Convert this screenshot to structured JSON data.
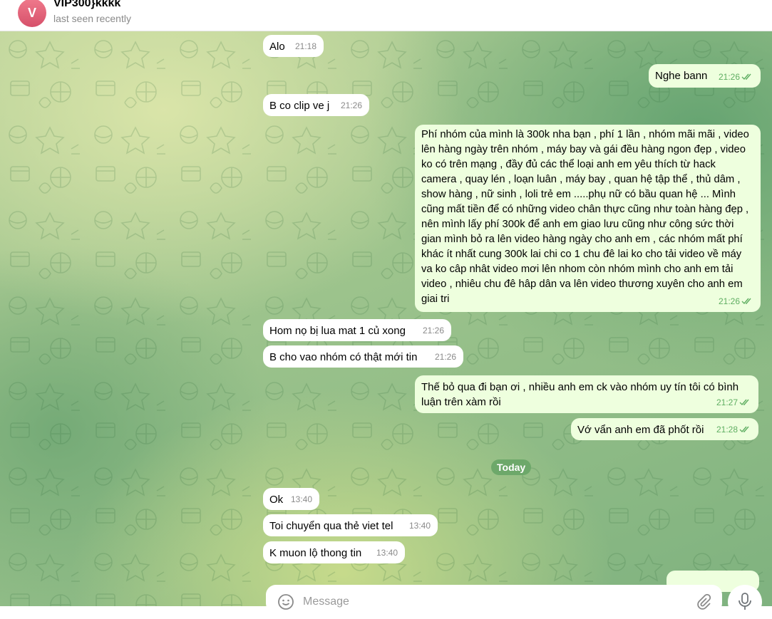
{
  "header": {
    "avatar_letter": "V",
    "title": "VIP300}kkkk",
    "status": "last seen recently"
  },
  "colors": {
    "outgoing_bubble": "#eeffde",
    "incoming_bubble": "#ffffff",
    "read_ticks": "#5fae62",
    "date_badge": "#6da86a",
    "avatar": "#e0607a"
  },
  "messages": [
    {
      "dir": "in",
      "text": "Alo",
      "time": "21:18"
    },
    {
      "dir": "out",
      "text": "Nghe bann",
      "time": "21:26",
      "status": "read"
    },
    {
      "dir": "in",
      "text": "B co clip ve j",
      "time": "21:26"
    },
    {
      "dir": "out",
      "text": "Phí nhóm của mình là 300k nha bạn , phí 1 lần , nhóm mãi mãi , video lên hàng ngày trên nhóm , máy bay và gái đều hàng ngon đẹp , video ko có trên mạng , đầy đủ các thể loại anh em yêu thích từ hack camera , quay lén , loạn luân , máy bay , quan hệ tập thể , thủ dâm , show hàng , nữ sinh , loli trẻ em .....phụ nữ có bầu quan hệ ... Mình cũng mất tiền để có những video chân thực cũng như toàn hàng đẹp , nên mình lấy phí 300k để anh em giao lưu cũng như công sức thời gian mình bỏ ra lên video hàng ngày cho anh em , các nhóm mất phí khác ít nhất cung 300k lai chi co 1 chu đê lai ko cho tải video về máy va ko câp nhât video mơi lên nhom còn nhóm mình cho anh em tải video , nhiêu chu đê hâp dân va lên video thương xuyên cho anh em giai tri",
      "time": "21:26",
      "status": "read"
    },
    {
      "dir": "in",
      "text": "Hom nọ bị lua mat 1 củ xong",
      "time": "21:26"
    },
    {
      "dir": "in",
      "text": "B cho vao nhóm có thật mới tin",
      "time": "21:26"
    },
    {
      "dir": "out",
      "text": "Thế bỏ qua đi bạn ơi , nhiều anh em ck vào nhóm uy tín tôi có bình luận trên xàm rồi",
      "time": "21:27",
      "status": "read"
    },
    {
      "dir": "out",
      "text": "Vớ vẩn anh em đã phốt rồi",
      "time": "21:28",
      "status": "read"
    },
    {
      "dir": "in",
      "text": "Ok",
      "time": "13:40"
    },
    {
      "dir": "in",
      "text": "Toi chuyển qua thẻ viet tel",
      "time": "13:40"
    },
    {
      "dir": "in",
      "text": "K muon lộ thong tin",
      "time": "13:40"
    }
  ],
  "date_separator": "Today",
  "composer": {
    "placeholder": "Message"
  },
  "icons": [
    "emoji-icon",
    "attach-icon",
    "microphone-icon",
    "double-check-icon"
  ]
}
